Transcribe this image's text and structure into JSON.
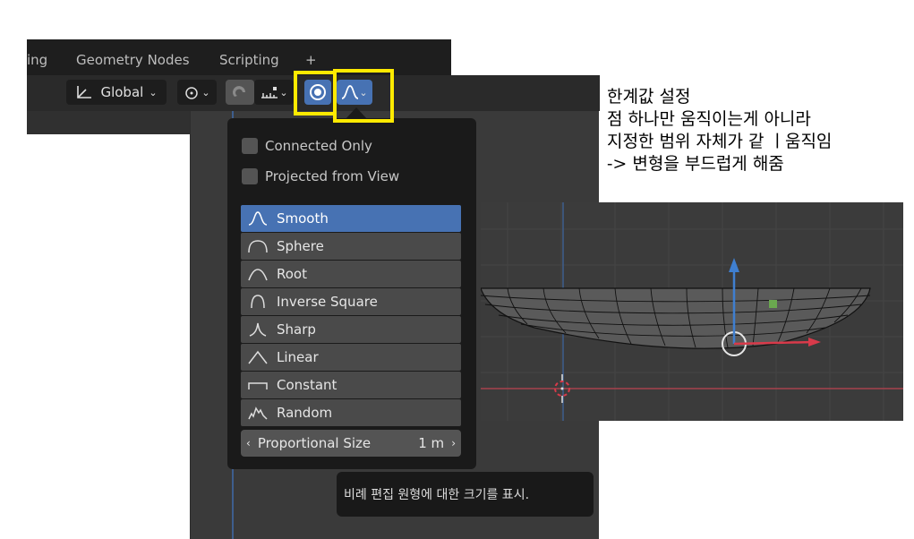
{
  "workspace_tabs": [
    {
      "label": "ing"
    },
    {
      "label": "Geometry Nodes"
    },
    {
      "label": "Scripting"
    },
    {
      "label": "+"
    }
  ],
  "toolbar": {
    "orientation_label": "Global"
  },
  "popup": {
    "checkboxes": [
      {
        "label": "Connected Only",
        "checked": false
      },
      {
        "label": "Projected from View",
        "checked": false
      }
    ],
    "falloff_items": [
      {
        "label": "Smooth",
        "icon": "smooth-falloff-icon",
        "active": true
      },
      {
        "label": "Sphere",
        "icon": "sphere-falloff-icon",
        "active": false
      },
      {
        "label": "Root",
        "icon": "root-falloff-icon",
        "active": false
      },
      {
        "label": "Inverse Square",
        "icon": "inverse-square-falloff-icon",
        "active": false
      },
      {
        "label": "Sharp",
        "icon": "sharp-falloff-icon",
        "active": false
      },
      {
        "label": "Linear",
        "icon": "linear-falloff-icon",
        "active": false
      },
      {
        "label": "Constant",
        "icon": "constant-falloff-icon",
        "active": false
      },
      {
        "label": "Random",
        "icon": "random-falloff-icon",
        "active": false
      }
    ],
    "proportional_size": {
      "label": "Proportional Size",
      "value": "1 m"
    }
  },
  "tooltip": "비례 편집 원형에 대한 크기를 표시.",
  "note": {
    "line1": "한계값 설정",
    "line2": "점 하나만 움직이는게 아니라",
    "line3": "지정한 범위 자체가 같 ㅣ움직임",
    "line4": "-> 변형을 부드럽게 해줌"
  },
  "colors": {
    "accent": "#4772b3",
    "highlight": "#ffea00",
    "axis_x": "#d83a4a",
    "axis_z": "#3f7fd0"
  }
}
